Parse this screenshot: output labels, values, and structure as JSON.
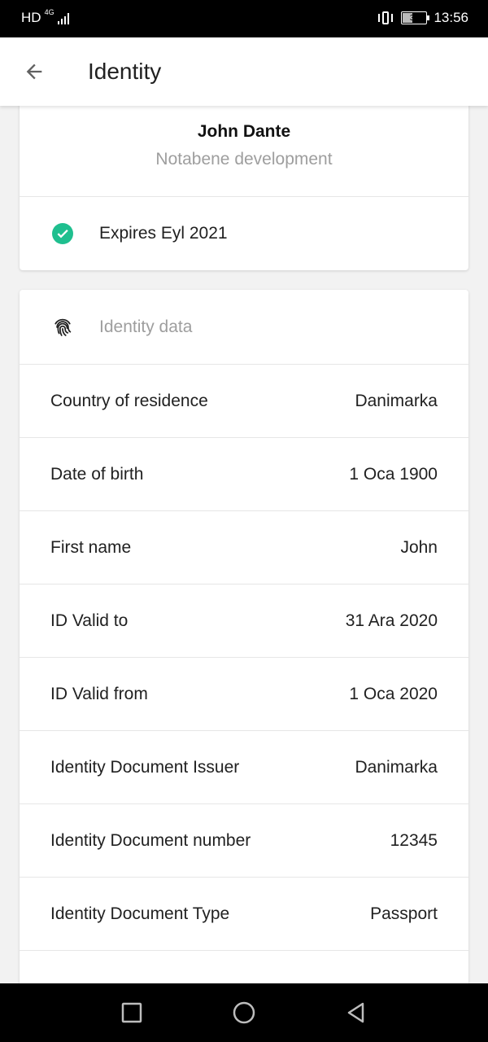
{
  "status_bar": {
    "hd": "HD",
    "network": "4G",
    "battery_level": "37",
    "time": "13:56"
  },
  "app_bar": {
    "title": "Identity",
    "back_icon": "arrow-back-icon"
  },
  "profile": {
    "name": "John Dante",
    "organization": "Notabene development"
  },
  "expiry": {
    "icon": "check-circle-icon",
    "text": "Expires Eyl 2021",
    "color": "#1fbf8f"
  },
  "identity_data": {
    "header_icon": "fingerprint-icon",
    "header": "Identity data",
    "rows": [
      {
        "label": "Country of residence",
        "value": "Danimarka"
      },
      {
        "label": "Date of birth",
        "value": "1 Oca 1900"
      },
      {
        "label": "First name",
        "value": "John"
      },
      {
        "label": "ID Valid to",
        "value": "31 Ara 2020"
      },
      {
        "label": "ID Valid from",
        "value": "1 Oca 2020"
      },
      {
        "label": "Identity Document Issuer",
        "value": "Danimarka"
      },
      {
        "label": "Identity Document number",
        "value": "12345"
      },
      {
        "label": "Identity Document Type",
        "value": "Passport"
      }
    ]
  },
  "nav_bar": {
    "recent_icon": "square-icon",
    "home_icon": "circle-icon",
    "back_icon": "triangle-back-icon"
  }
}
